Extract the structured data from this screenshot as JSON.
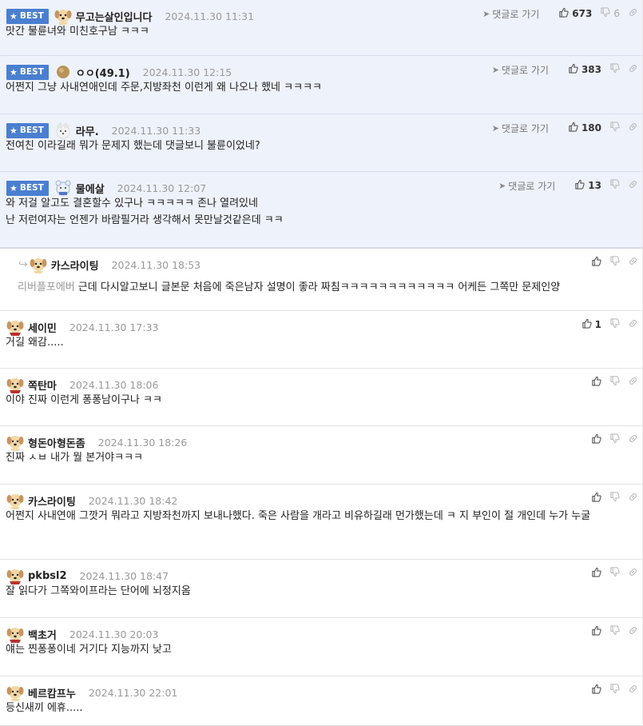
{
  "labels": {
    "best": "BEST",
    "goto": "댓글로 가기"
  },
  "comments": [
    {
      "best": true,
      "nick": "무고는살인입니다",
      "date": "2024.11.30 11:31",
      "text": "맛간 불륜녀와 미친호구남 ㅋㅋㅋ",
      "up": "673",
      "down": "6",
      "avatar": "puppy",
      "show_goto": true
    },
    {
      "best": true,
      "nick": "ㅇㅇ(49.1)",
      "date": "2024.11.30 12:15",
      "text": "어쩐지 그냥 사내연애인데 주문,지방좌천 이런게 왜 나오나 했네 ㅋㅋㅋㅋ",
      "up": "383",
      "down": "",
      "avatar": "dot",
      "show_goto": true
    },
    {
      "best": true,
      "nick": "라무.",
      "date": "2024.11.30 11:33",
      "text": "전여친 이라길래 뭐가 문제지 했는데 댓글보니 불륜이었네?",
      "up": "180",
      "down": "",
      "avatar": "white",
      "show_goto": true
    },
    {
      "best": true,
      "nick": "물에살",
      "date": "2024.11.30 12:07",
      "text": "와 저걸 알고도 결혼할수 있구나 ㅋㅋㅋㅋㅋ 존나 열려있네\n난 저런여자는 언젠가 바람필거라 생각해서 못만날것같은데 ㅋㅋ",
      "up": "13",
      "down": "",
      "avatar": "bear",
      "show_goto": true
    },
    {
      "reply": true,
      "nick": "카스라이팅",
      "date": "2024.11.30 18:53",
      "mention": "리버플포에버",
      "text": "근데 다시알고보니 글본문 처음에 죽은남자 설명이 좋라 짜침ㅋㅋㅋㅋㅋㅋㅋㅋㅋㅋㅋㅋ 어케든 그쪽만 문제인양",
      "up": "",
      "down": "",
      "avatar": "puppy"
    },
    {
      "nick": "세이민",
      "date": "2024.11.30 17:33",
      "text": "거길 왜감.....",
      "up": "1",
      "down": "",
      "avatar": "redpuppy"
    },
    {
      "nick": "쪽탄마",
      "date": "2024.11.30 18:06",
      "text": "이야 진짜 이런게 퐁퐁남이구나 ㅋㅋ",
      "up": "",
      "down": "",
      "avatar": "redpuppy"
    },
    {
      "nick": "형돈아형돈좀",
      "date": "2024.11.30 18:26",
      "text": "진짜 ㅅㅂ 내가 뭘 본거야ㅋㅋㅋ",
      "up": "",
      "down": "",
      "avatar": "puppy"
    },
    {
      "nick": "카스라이팅",
      "date": "2024.11.30 18:42",
      "text": "어쩐지 사내연애 그깟거 뭐라고 지방좌천까지 보내나했다. 죽은 사람을 개라고 비유하길래 먼가했는데 ㅋ 지 부인이 절 개인데 누가 누굴",
      "up": "",
      "down": "",
      "avatar": "puppy"
    },
    {
      "nick": "pkbsl2",
      "date": "2024.11.30 18:47",
      "text": "잘 읽다가 그쪽와이프라는 단어에 뇌정지옴",
      "up": "",
      "down": "",
      "avatar": "redpuppy"
    },
    {
      "nick": "백초거",
      "date": "2024.11.30 20:03",
      "text": "얘는 찐퐁퐁이네 거기다 지능까지 낮고",
      "up": "",
      "down": "",
      "avatar": "redpuppy"
    },
    {
      "nick": "베르캄프누",
      "date": "2024.11.30 22:01",
      "text": "등신새끼 에휴.....",
      "up": "",
      "down": "",
      "avatar": "puppy"
    }
  ],
  "colors": {
    "badge": "#4a7fd0",
    "best_bg": "#eef2fa",
    "meta": "#999999"
  }
}
